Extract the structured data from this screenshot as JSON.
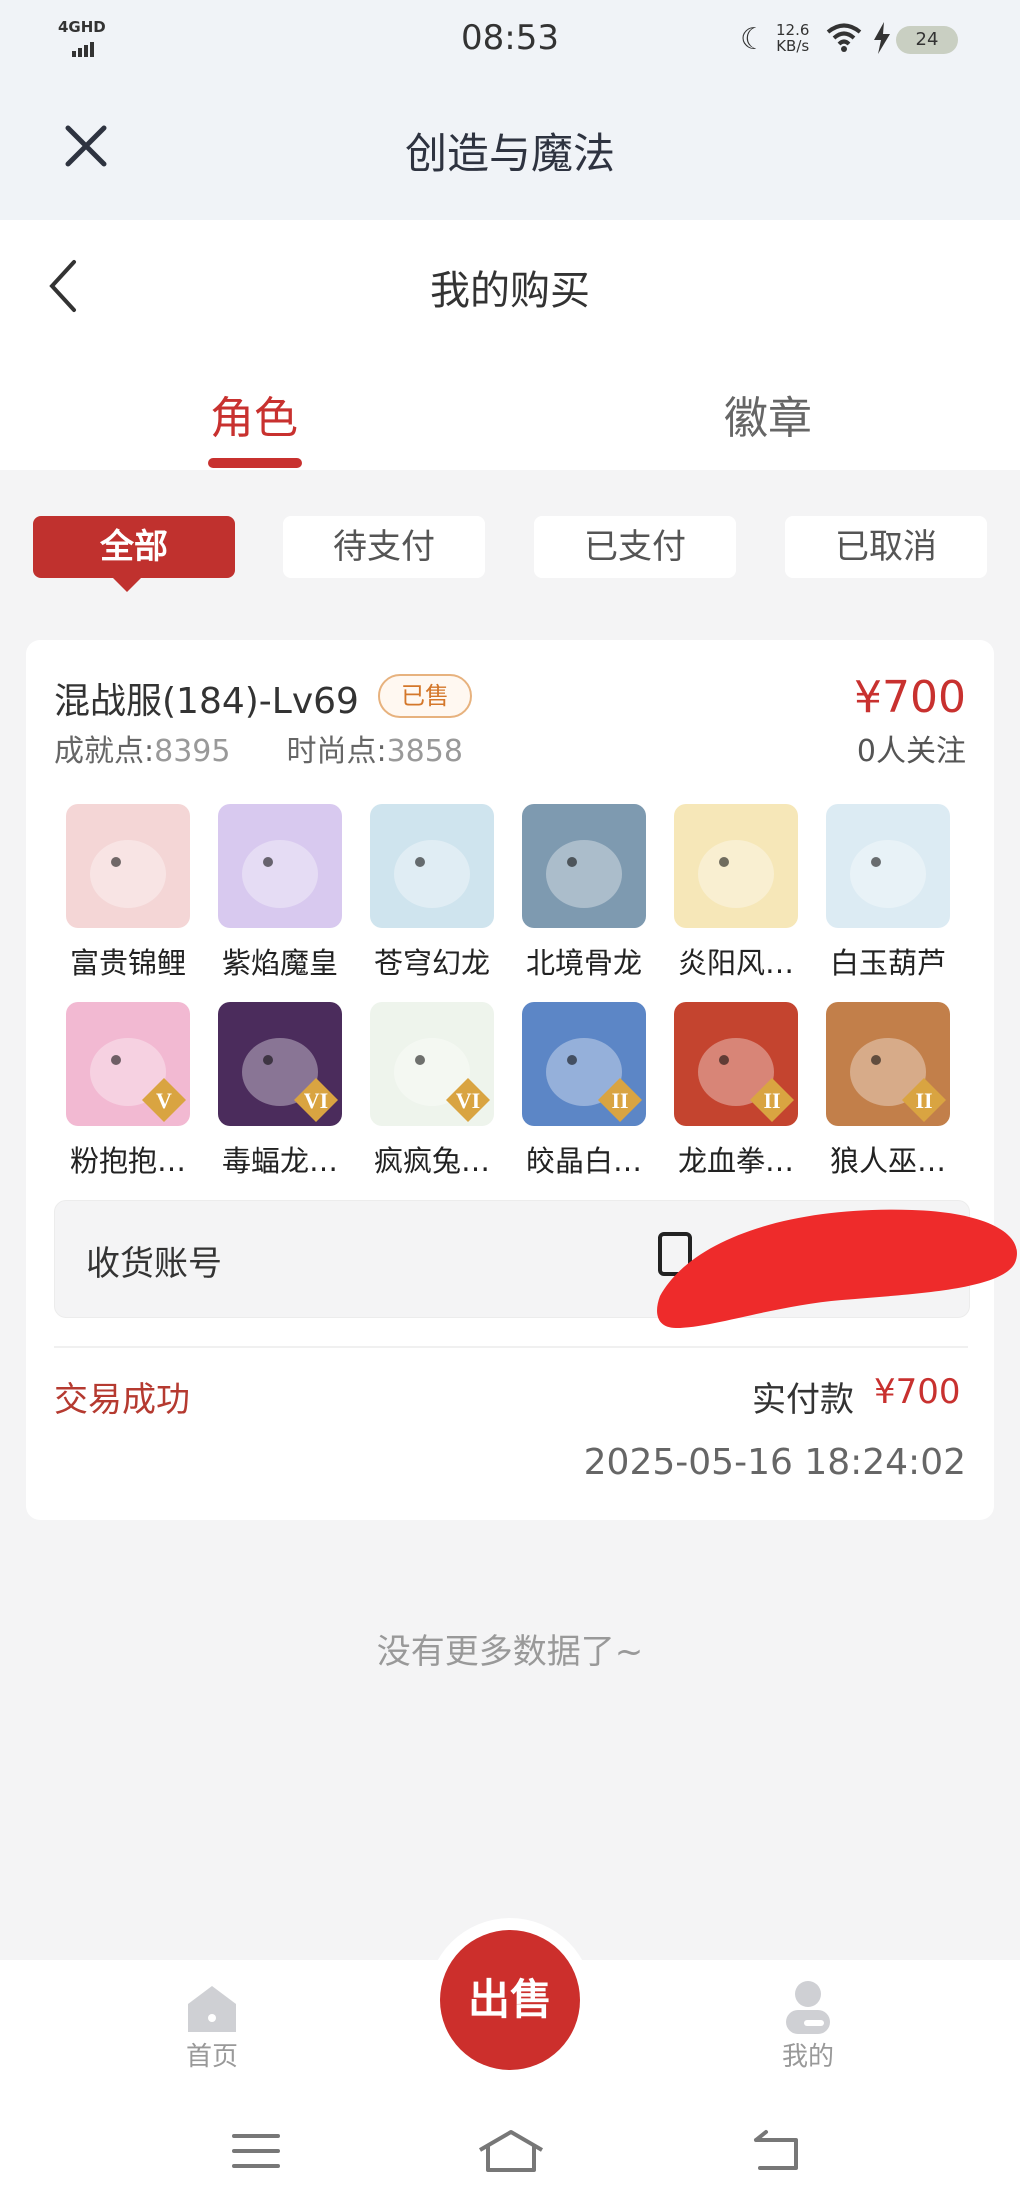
{
  "status_bar": {
    "network": "4GHD",
    "time": "08:53",
    "net_speed_value": "12.6",
    "net_speed_unit": "KB/s",
    "battery": "24"
  },
  "app": {
    "title": "创造与魔法"
  },
  "page": {
    "title": "我的购买"
  },
  "tabs": [
    {
      "label": "角色",
      "active": true
    },
    {
      "label": "徽章",
      "active": false
    }
  ],
  "filters": [
    {
      "label": "全部",
      "active": true
    },
    {
      "label": "待支付",
      "active": false
    },
    {
      "label": "已支付",
      "active": false
    },
    {
      "label": "已取消",
      "active": false
    }
  ],
  "order": {
    "server": "混战服(184)-Lv69",
    "status_badge": "已售",
    "price": "¥700",
    "achievement_label": "成就点:",
    "achievement_value": "8395",
    "fashion_label": "时尚点:",
    "fashion_value": "3858",
    "followers": "0人关注",
    "pets": [
      {
        "name": "富贵锦鲤",
        "color": "#f4d6d6",
        "icon": "koi-pet-icon"
      },
      {
        "name": "紫焰魔皇",
        "color": "#d8c9ef",
        "icon": "purple-flame-pet-icon"
      },
      {
        "name": "苍穹幻龙",
        "color": "#cfe4ee",
        "icon": "sky-dragon-pet-icon"
      },
      {
        "name": "北境骨龙",
        "color": "#7e9ab0",
        "icon": "bone-dragon-pet-icon"
      },
      {
        "name": "炎阳风…",
        "color": "#f6e7b8",
        "icon": "sun-wind-pet-icon"
      },
      {
        "name": "白玉葫芦",
        "color": "#dcebf3",
        "icon": "jade-gourd-pet-icon"
      },
      {
        "name": "粉抱抱…",
        "color": "#f2b9d2",
        "icon": "pink-hug-pet-icon",
        "tier": "V"
      },
      {
        "name": "毒蝠龙…",
        "color": "#4b2c5c",
        "icon": "venom-bat-dragon-pet-icon",
        "tier": "VI"
      },
      {
        "name": "疯疯兔…",
        "color": "#eef4ec",
        "icon": "crazy-rabbit-pet-icon",
        "tier": "VI"
      },
      {
        "name": "皎晶白…",
        "color": "#5c86c6",
        "icon": "crystal-white-pet-icon",
        "tier": "II"
      },
      {
        "name": "龙血拳…",
        "color": "#c4442f",
        "icon": "dragon-blood-fist-pet-icon",
        "tier": "II"
      },
      {
        "name": "狼人巫…",
        "color": "#c27f4a",
        "icon": "werewolf-shaman-pet-icon",
        "tier": "II"
      }
    ],
    "account_label": "收货账号",
    "trade_status": "交易成功",
    "paid_label": "实付款",
    "paid_amount": "¥700",
    "timestamp": "2025-05-16 18:24:02"
  },
  "list_end": "没有更多数据了~",
  "bottom_nav": {
    "home_label": "首页",
    "sell_label": "出售",
    "me_label": "我的"
  },
  "colors": {
    "accent": "#c8312f",
    "badge_border": "#e7b27e",
    "badge_text": "#d4772a",
    "redaction": "#ee2b2b"
  }
}
